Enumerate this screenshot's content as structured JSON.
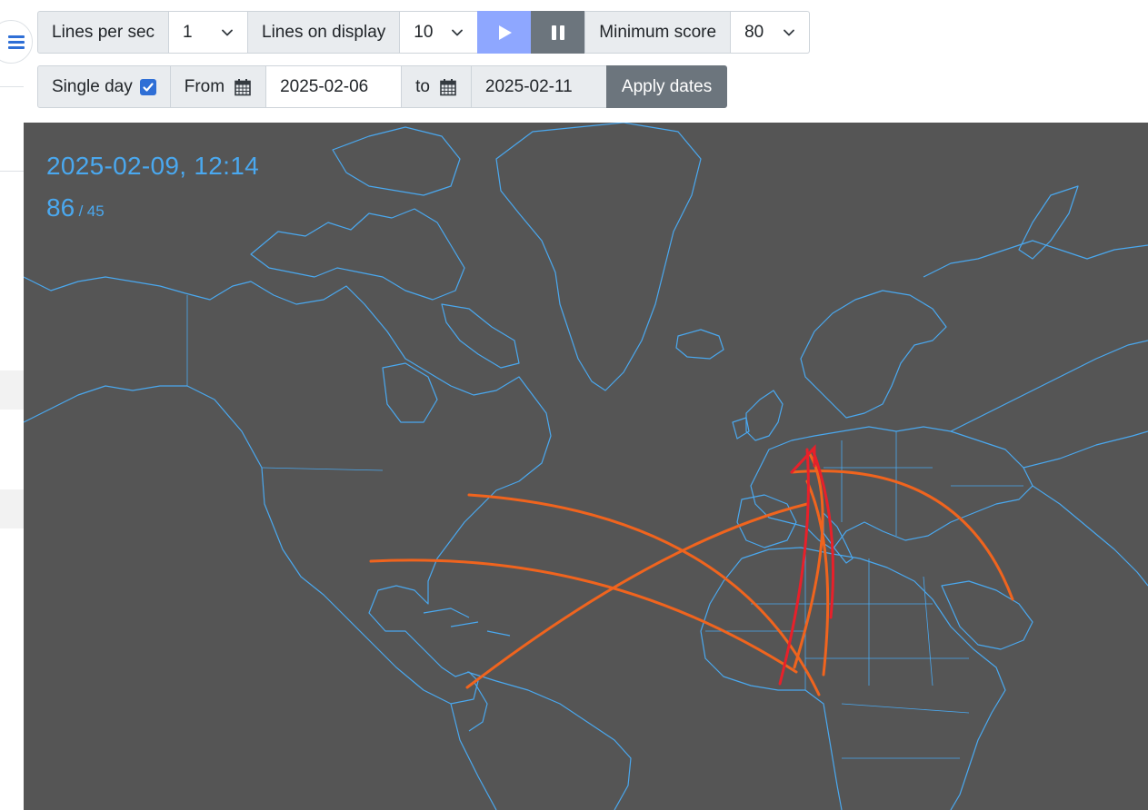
{
  "controls": {
    "lines_per_sec_label": "Lines per sec",
    "lines_per_sec_value": "1",
    "lines_on_display_label": "Lines on display",
    "lines_on_display_value": "10",
    "minimum_score_label": "Minimum score",
    "minimum_score_value": "80",
    "single_day_label": "Single day",
    "single_day_checked": true,
    "from_label": "From",
    "from_date": "2025-02-06",
    "to_label": "to",
    "to_date": "2025-02-11",
    "apply_label": "Apply dates"
  },
  "overlay": {
    "timestamp": "2025-02-09, 12:14",
    "count": "86",
    "separator": "/",
    "total": "45"
  },
  "colors": {
    "map_background": "#555555",
    "coastline": "#4aa8ef",
    "overlay_text": "#4aa8ef",
    "arc_orange": "#f0641e",
    "arc_red": "#e8202a",
    "play_button": "#8ea7ff",
    "pause_button": "#6c757d",
    "checkbox": "#2f6fd6"
  },
  "icons": [
    "menu-icon",
    "play-icon",
    "pause-icon",
    "calendar-icon",
    "chevron-down-icon",
    "checkmark-icon"
  ]
}
